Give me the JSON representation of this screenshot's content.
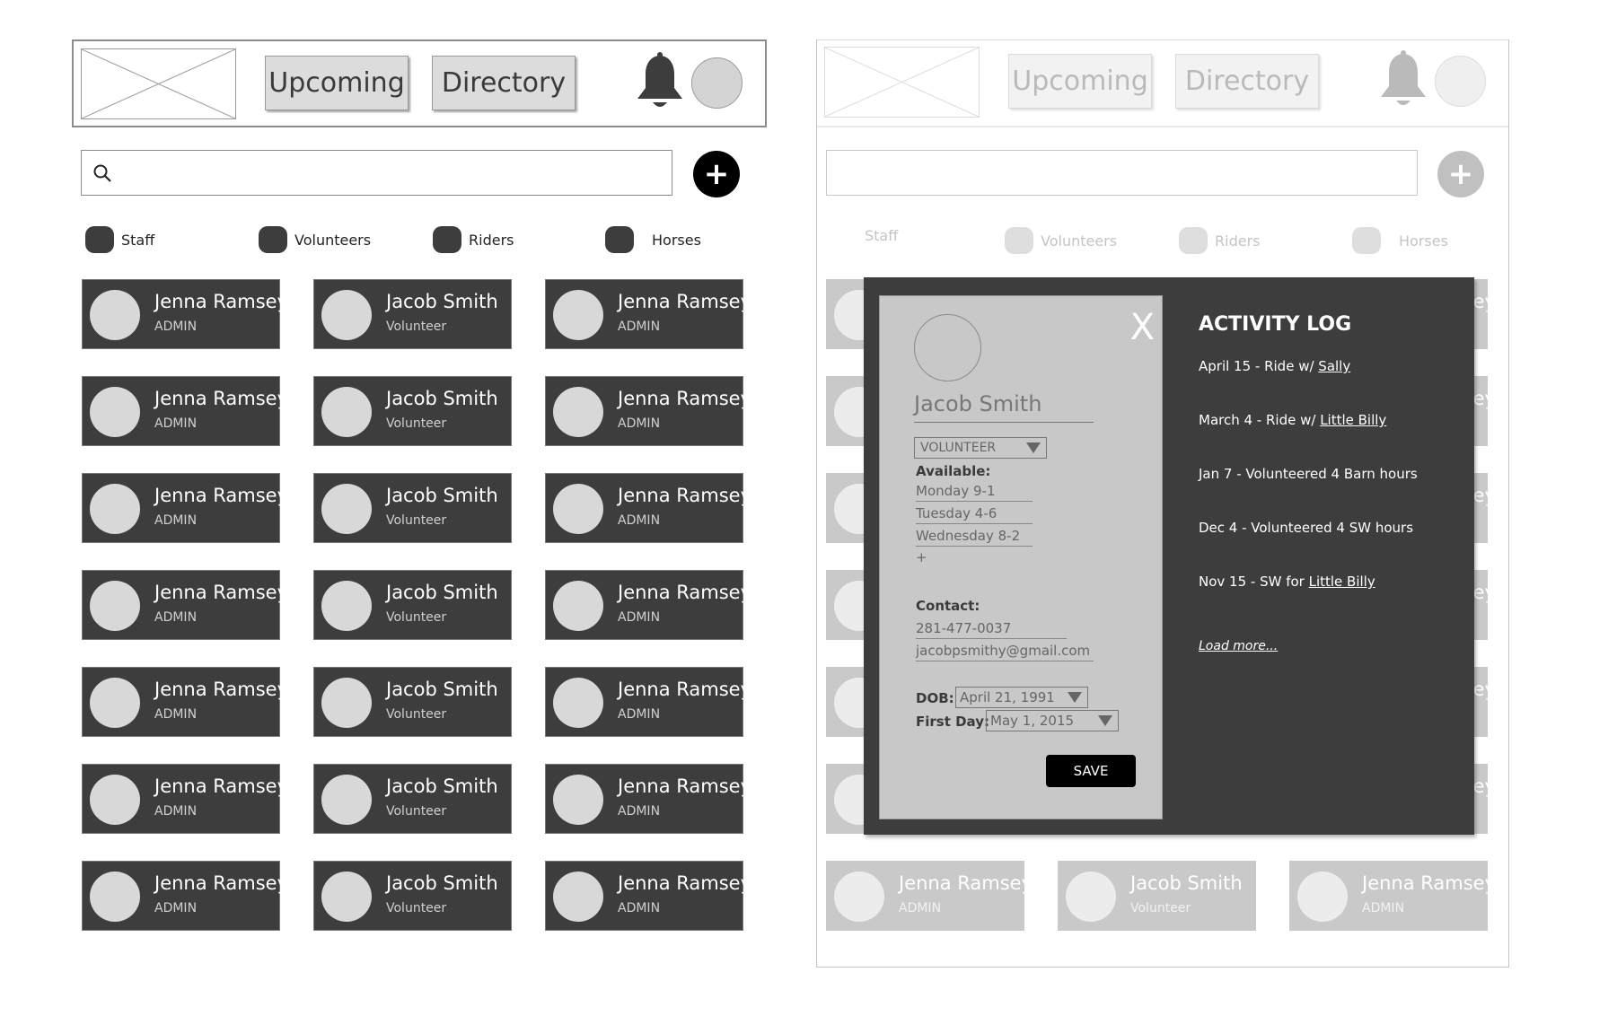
{
  "header": {
    "nav": [
      "Upcoming",
      "Directory"
    ],
    "icons": [
      "logo-placeholder",
      "bell-icon",
      "avatar"
    ]
  },
  "search": {
    "value": "",
    "placeholder": ""
  },
  "filters": [
    "Staff",
    "Volunteers",
    "Riders",
    "Horses"
  ],
  "cards": [
    {
      "name": "Jenna Ramsey",
      "role": "ADMIN"
    },
    {
      "name": "Jacob Smith",
      "role": "Volunteer"
    },
    {
      "name": "Jenna Ramsey",
      "role": "ADMIN"
    }
  ],
  "modal": {
    "close": "X",
    "name": "Jacob Smith",
    "role_select": "VOLUNTEER",
    "available_label": "Available:",
    "availability": [
      "Monday 9-1",
      "Tuesday 4-6",
      "Wednesday 8-2"
    ],
    "add_availability": "+",
    "contact_label": "Contact:",
    "phone": "281-477-0037",
    "email": "jacobpsmithy@gmail.com",
    "dob_label": "DOB:",
    "dob_value": "April 21, 1991",
    "first_day_label": "First Day:",
    "first_day_value": "May 1, 2015",
    "save": "SAVE",
    "activity_title": "ACTIVITY LOG",
    "activity": [
      {
        "text": "April 15 - Ride w/ ",
        "link": "Sally"
      },
      {
        "text": "March  4 - Ride w/ ",
        "link": "Little Billy"
      },
      {
        "text": "Jan 7 - Volunteered 4 Barn hours",
        "link": ""
      },
      {
        "text": "Dec 4 - Volunteered 4 SW hours",
        "link": ""
      },
      {
        "text": "Nov 15 - SW for ",
        "link": "Little Billy"
      }
    ],
    "load_more": "Load more..."
  },
  "colors": {
    "card_dark": "#3d3d3d",
    "card_faded": "#c9c9c9",
    "modal_bg": "#3d3d3d",
    "profile_bg": "#c8c8c8",
    "accent_black": "#000000"
  }
}
